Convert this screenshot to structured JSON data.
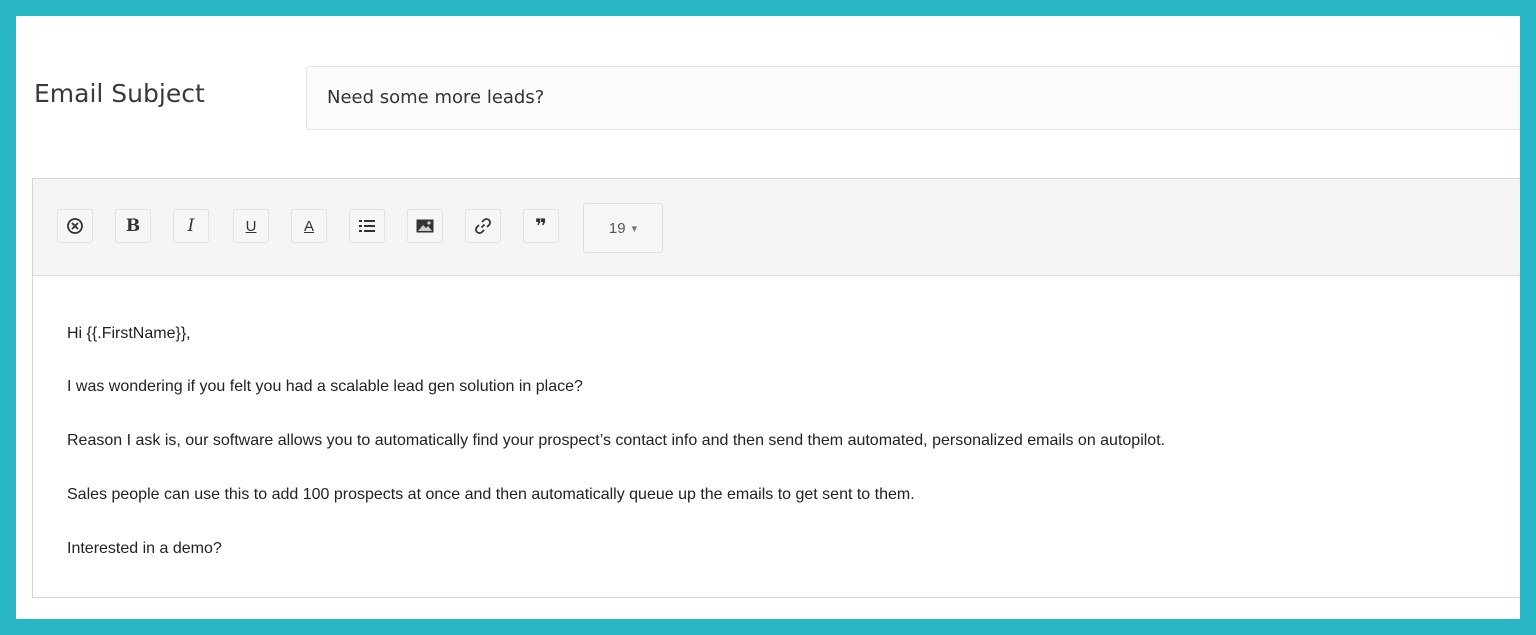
{
  "subject": {
    "label": "Email Subject",
    "value": "Need some more leads?"
  },
  "toolbar": {
    "buttons": [
      {
        "name": "clear-format",
        "icon": "clear-format-icon",
        "glyph": "⊗"
      },
      {
        "name": "bold",
        "icon": "bold-icon",
        "glyph": "B"
      },
      {
        "name": "italic",
        "icon": "italic-icon",
        "glyph": "I"
      },
      {
        "name": "underline",
        "icon": "underline-icon",
        "glyph": "U"
      },
      {
        "name": "text-color",
        "icon": "text-color-icon",
        "glyph": "A"
      },
      {
        "name": "list",
        "icon": "list-icon",
        "glyph": "≣"
      },
      {
        "name": "image",
        "icon": "image-icon",
        "glyph": ""
      },
      {
        "name": "link",
        "icon": "link-icon",
        "glyph": ""
      },
      {
        "name": "quote",
        "icon": "quote-icon",
        "glyph": "❞"
      }
    ],
    "font_size": {
      "value": "19",
      "caret": "▾"
    }
  },
  "body": {
    "paragraphs": [
      "Hi {{.FirstName}},",
      "I was wondering if you felt you had a scalable lead gen solution in place?",
      "Reason I ask is, our software allows you to automatically find your prospect’s contact info and then send them automated, personalized emails on autopilot.",
      "Sales people can use this to add 100 prospects at once and then automatically queue up the emails to get sent to them.",
      "Interested in a demo?"
    ]
  },
  "colors": {
    "frame": "#28b5c4",
    "toolbar_bg": "#f5f5f5",
    "text": "#222222"
  }
}
